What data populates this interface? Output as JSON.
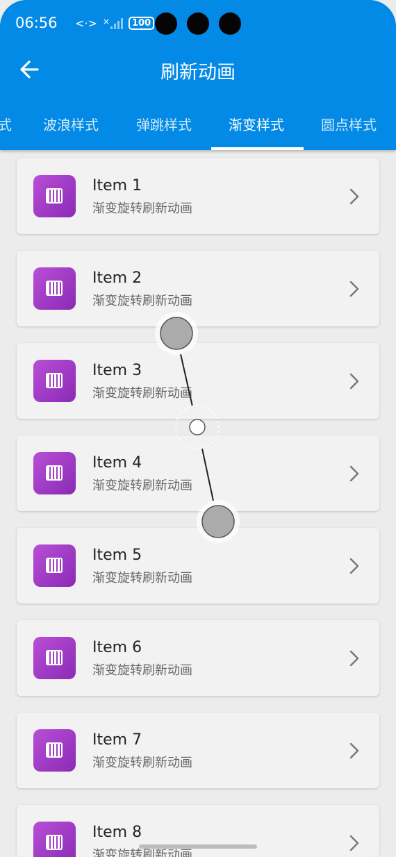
{
  "status_bar": {
    "time": "06:56",
    "data_icon": "<·>",
    "signal_x": "×",
    "battery": "100"
  },
  "header": {
    "title": "刷新动画",
    "back_icon": "arrow-left-icon"
  },
  "tabs": [
    {
      "label": "式",
      "active": false
    },
    {
      "label": "波浪样式",
      "active": false
    },
    {
      "label": "弹跳样式",
      "active": false
    },
    {
      "label": "渐变样式",
      "active": true
    },
    {
      "label": "圆点样式",
      "active": false
    }
  ],
  "items": [
    {
      "title": "Item 1",
      "subtitle": "渐变旋转刷新动画"
    },
    {
      "title": "Item 2",
      "subtitle": "渐变旋转刷新动画"
    },
    {
      "title": "Item 3",
      "subtitle": "渐变旋转刷新动画"
    },
    {
      "title": "Item 4",
      "subtitle": "渐变旋转刷新动画"
    },
    {
      "title": "Item 5",
      "subtitle": "渐变旋转刷新动画"
    },
    {
      "title": "Item 6",
      "subtitle": "渐变旋转刷新动画"
    },
    {
      "title": "Item 7",
      "subtitle": "渐变旋转刷新动画"
    },
    {
      "title": "Item 8",
      "subtitle": "渐变旋转刷新动画"
    }
  ],
  "colors": {
    "app_bar": "#038ae6",
    "thumb_start": "#b94ed6",
    "thumb_end": "#8a2bb5"
  }
}
